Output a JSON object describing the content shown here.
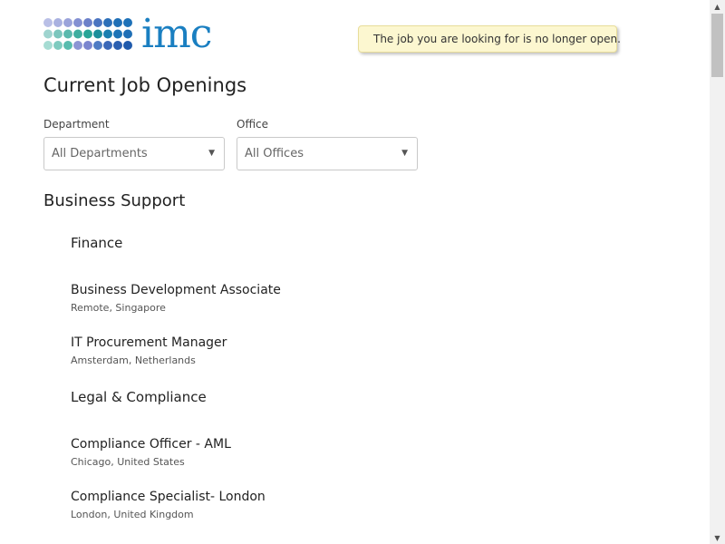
{
  "logo": {
    "text": "imc",
    "brand_color": "#1a7fc1"
  },
  "notice": {
    "icon": "clock-icon",
    "text": "The job you are looking for is no longer open.",
    "background": "#fcf7d0"
  },
  "page_title": "Current Job Openings",
  "filters": {
    "department": {
      "label": "Department",
      "value": "All Departments"
    },
    "office": {
      "label": "Office",
      "value": "All Offices"
    }
  },
  "sections": [
    {
      "title": "Business Support",
      "departments": [
        {
          "name": "Finance",
          "jobs": [
            {
              "title": "Business Development Associate",
              "location": "Remote, Singapore"
            },
            {
              "title": "IT Procurement Manager",
              "location": "Amsterdam, Netherlands"
            }
          ]
        },
        {
          "name": "Legal & Compliance",
          "jobs": [
            {
              "title": "Compliance Officer - AML",
              "location": "Chicago, United States"
            },
            {
              "title": "Compliance Specialist- London",
              "location": "London, United Kingdom"
            }
          ]
        }
      ]
    }
  ]
}
